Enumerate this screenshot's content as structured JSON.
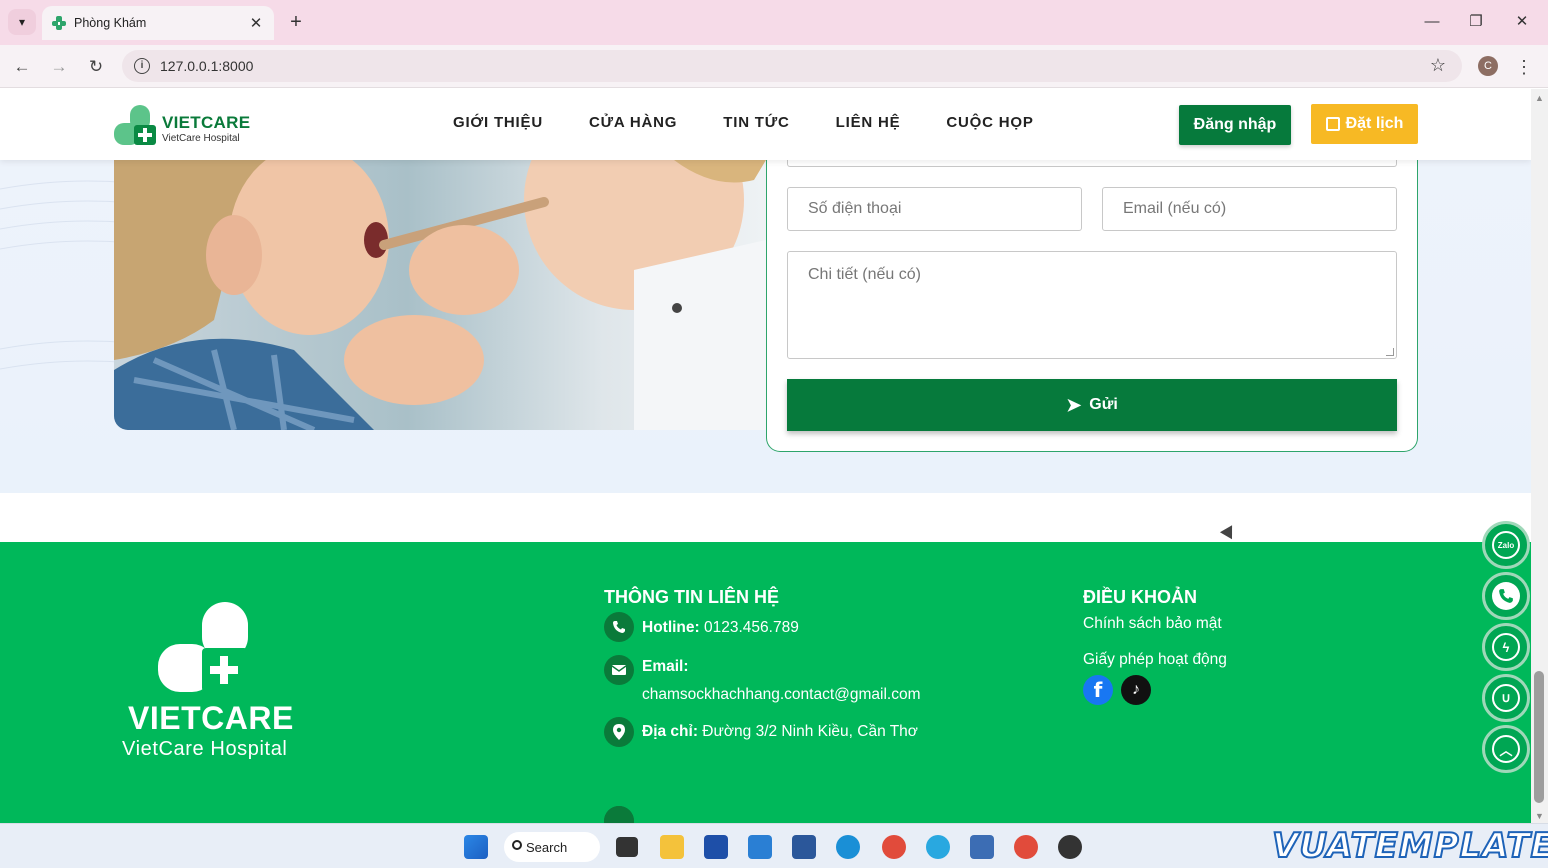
{
  "browser": {
    "tab_title": "Phòng Khám",
    "url": "127.0.0.1:8000",
    "profile_initial": "C"
  },
  "site": {
    "brand": "VIETCARE",
    "brand_sub": "VietCare Hospital",
    "nav": [
      "GIỚI THIỆU",
      "CỬA HÀNG",
      "TIN TỨC",
      "LIÊN HỆ",
      "CUỘC HỌP"
    ],
    "login_label": "Đăng nhập",
    "book_label": "Đặt lịch"
  },
  "form": {
    "phone_placeholder": "Số điện thoại",
    "email_placeholder": "Email (nếu có)",
    "detail_placeholder": "Chi tiết (nếu có)",
    "send_label": "Gửi"
  },
  "footer": {
    "brand": "VIETCARE",
    "brand_sub": "VietCare Hospital",
    "contact_title": "THÔNG TIN LIÊN HỆ",
    "hotline_label": "Hotline:",
    "hotline_value": "0123.456.789",
    "email_label": "Email:",
    "email_value": "chamsockhachhang.contact@gmail.com",
    "address_label": "Địa chỉ:",
    "address_value": "Đường 3/2 Ninh Kiều, Cần Thơ",
    "terms_title": "ĐIỀU KHOẢN",
    "privacy": "Chính sách bảo mật",
    "license": "Giấy phép hoạt động"
  },
  "floating": {
    "zalo_label": "Zalo"
  },
  "taskbar": {
    "search_label": "Search"
  },
  "watermark": "VUATEMPLATE",
  "colors": {
    "primary_green": "#067a3c",
    "footer_green": "#00b85a",
    "accent_yellow": "#f7b924",
    "tab_bar": "#f6dbe8"
  }
}
